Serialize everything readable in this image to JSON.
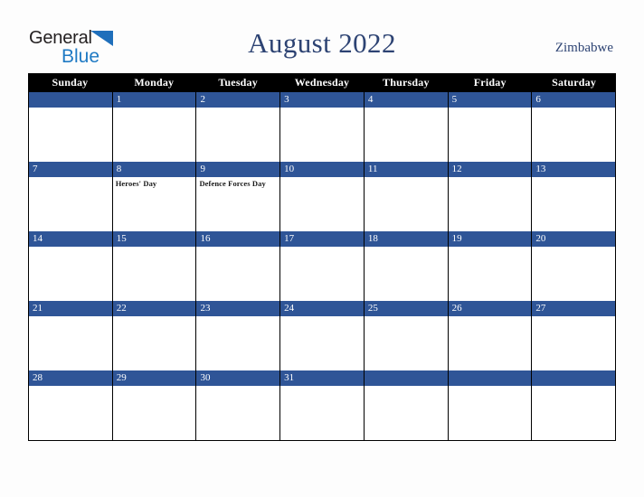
{
  "brand": {
    "name_part1": "General",
    "name_part2": "Blue",
    "triangle_color": "#1f6fbb",
    "blue_color": "#1f7ac4",
    "dark_color": "#231f20"
  },
  "header": {
    "title": "August 2022",
    "country": "Zimbabwe",
    "title_color": "#2d4373"
  },
  "calendar": {
    "accent_color": "#2f5597",
    "header_bg": "#000000",
    "weekdays": [
      "Sunday",
      "Monday",
      "Tuesday",
      "Wednesday",
      "Thursday",
      "Friday",
      "Saturday"
    ],
    "weeks": [
      [
        {
          "day": "",
          "event": ""
        },
        {
          "day": "1",
          "event": ""
        },
        {
          "day": "2",
          "event": ""
        },
        {
          "day": "3",
          "event": ""
        },
        {
          "day": "4",
          "event": ""
        },
        {
          "day": "5",
          "event": ""
        },
        {
          "day": "6",
          "event": ""
        }
      ],
      [
        {
          "day": "7",
          "event": ""
        },
        {
          "day": "8",
          "event": "Heroes' Day"
        },
        {
          "day": "9",
          "event": "Defence Forces Day"
        },
        {
          "day": "10",
          "event": ""
        },
        {
          "day": "11",
          "event": ""
        },
        {
          "day": "12",
          "event": ""
        },
        {
          "day": "13",
          "event": ""
        }
      ],
      [
        {
          "day": "14",
          "event": ""
        },
        {
          "day": "15",
          "event": ""
        },
        {
          "day": "16",
          "event": ""
        },
        {
          "day": "17",
          "event": ""
        },
        {
          "day": "18",
          "event": ""
        },
        {
          "day": "19",
          "event": ""
        },
        {
          "day": "20",
          "event": ""
        }
      ],
      [
        {
          "day": "21",
          "event": ""
        },
        {
          "day": "22",
          "event": ""
        },
        {
          "day": "23",
          "event": ""
        },
        {
          "day": "24",
          "event": ""
        },
        {
          "day": "25",
          "event": ""
        },
        {
          "day": "26",
          "event": ""
        },
        {
          "day": "27",
          "event": ""
        }
      ],
      [
        {
          "day": "28",
          "event": ""
        },
        {
          "day": "29",
          "event": ""
        },
        {
          "day": "30",
          "event": ""
        },
        {
          "day": "31",
          "event": ""
        },
        {
          "day": "",
          "event": ""
        },
        {
          "day": "",
          "event": ""
        },
        {
          "day": "",
          "event": ""
        }
      ]
    ]
  }
}
